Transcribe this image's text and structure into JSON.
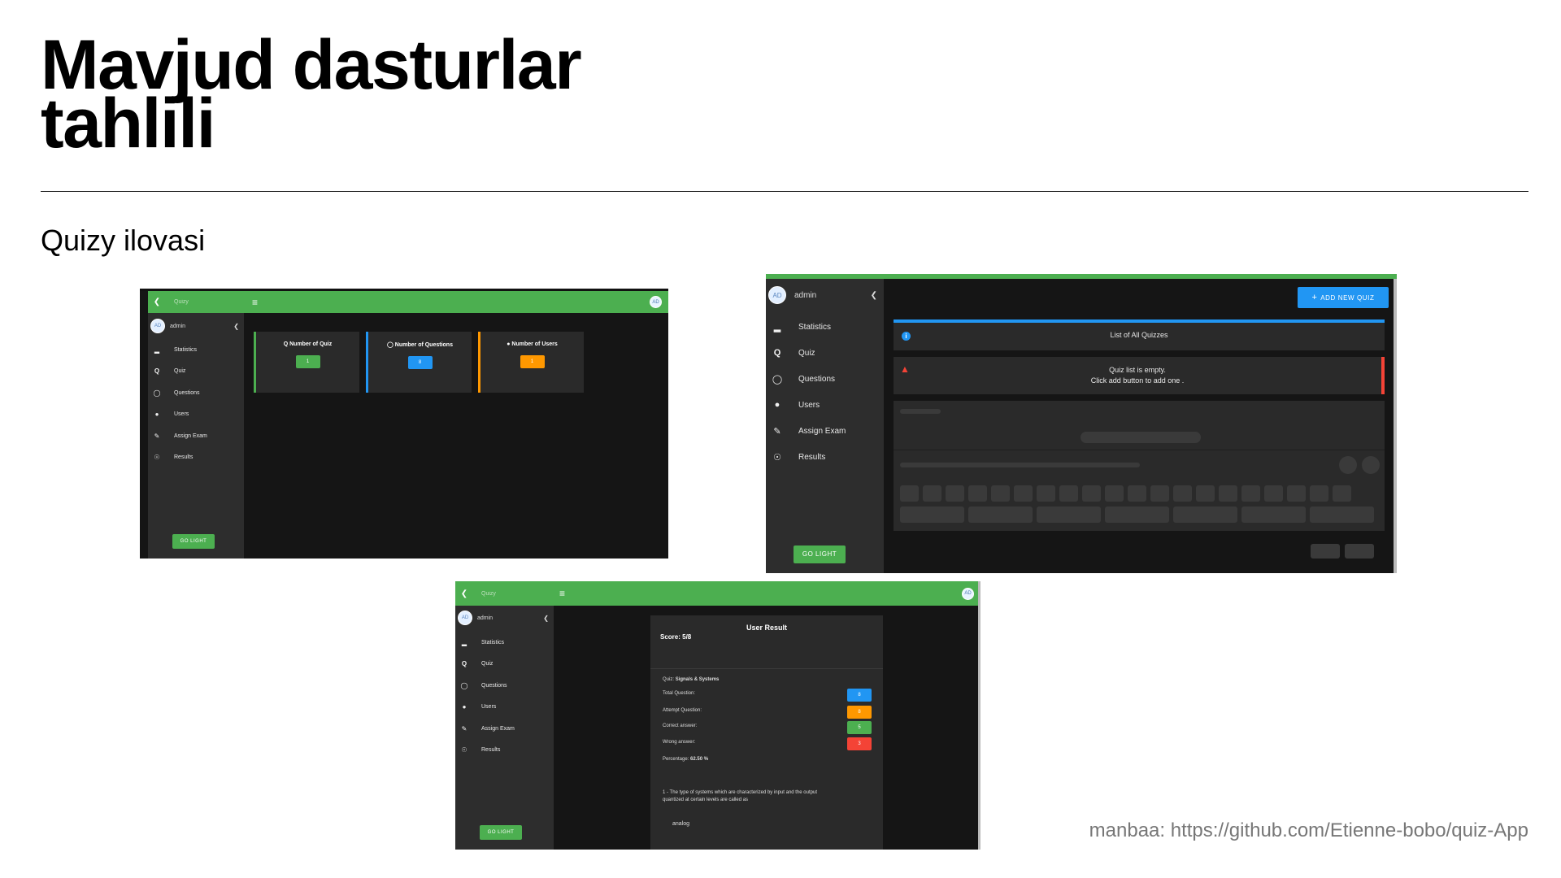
{
  "slide": {
    "title_line1": "Mavjud dasturlar",
    "title_line2": "tahlili",
    "subtitle": "Quizy ilovasi",
    "source": "manbaa: https://github.com/Etienne-bobo/quiz-App"
  },
  "colors": {
    "green": "#4caf50",
    "blue": "#2196f3",
    "orange": "#ff9800",
    "red": "#f44336",
    "sidebar": "#2d2d2d",
    "content": "#151515"
  },
  "app": {
    "brand": "Quizy",
    "avatar_initials": "AD",
    "user_name": "admin",
    "go_light": "GO LIGHT",
    "nav": [
      {
        "label": "Statistics",
        "icon": "bar-chart-icon"
      },
      {
        "label": "Quiz",
        "icon": "quiz-icon"
      },
      {
        "label": "Questions",
        "icon": "question-icon"
      },
      {
        "label": "Users",
        "icon": "user-icon"
      },
      {
        "label": "Assign Exam",
        "icon": "assign-icon"
      },
      {
        "label": "Results",
        "icon": "results-icon"
      }
    ]
  },
  "shot1": {
    "cards": [
      {
        "label": "Number of Quiz",
        "value": "1"
      },
      {
        "label": "Number of Questions",
        "value": "8"
      },
      {
        "label": "Number of Users",
        "value": "1"
      }
    ]
  },
  "shot2": {
    "add_button": "ADD NEW QUIZ",
    "list_title": "List of All Quizzes",
    "empty_line1": "Quiz list is empty.",
    "empty_line2": "Click add button to add one ."
  },
  "shot3": {
    "result_title": "User Result",
    "score": "Score: 5/8",
    "quiz_prefix": "Quiz:",
    "quiz_name": "Signals & Systems",
    "stats": [
      {
        "label": "Total Question:",
        "value": "8"
      },
      {
        "label": "Attempt Question:",
        "value": "8"
      },
      {
        "label": "Correct answer:",
        "value": "5"
      },
      {
        "label": "Wrong answer:",
        "value": "3"
      }
    ],
    "percentage_label": "Percentage:",
    "percentage_value": "62.50 %",
    "question_line1": "1 - The type of systems which are characterized by input and the output",
    "question_line2": "quantized at certain levels are called as",
    "answer": "analog"
  }
}
